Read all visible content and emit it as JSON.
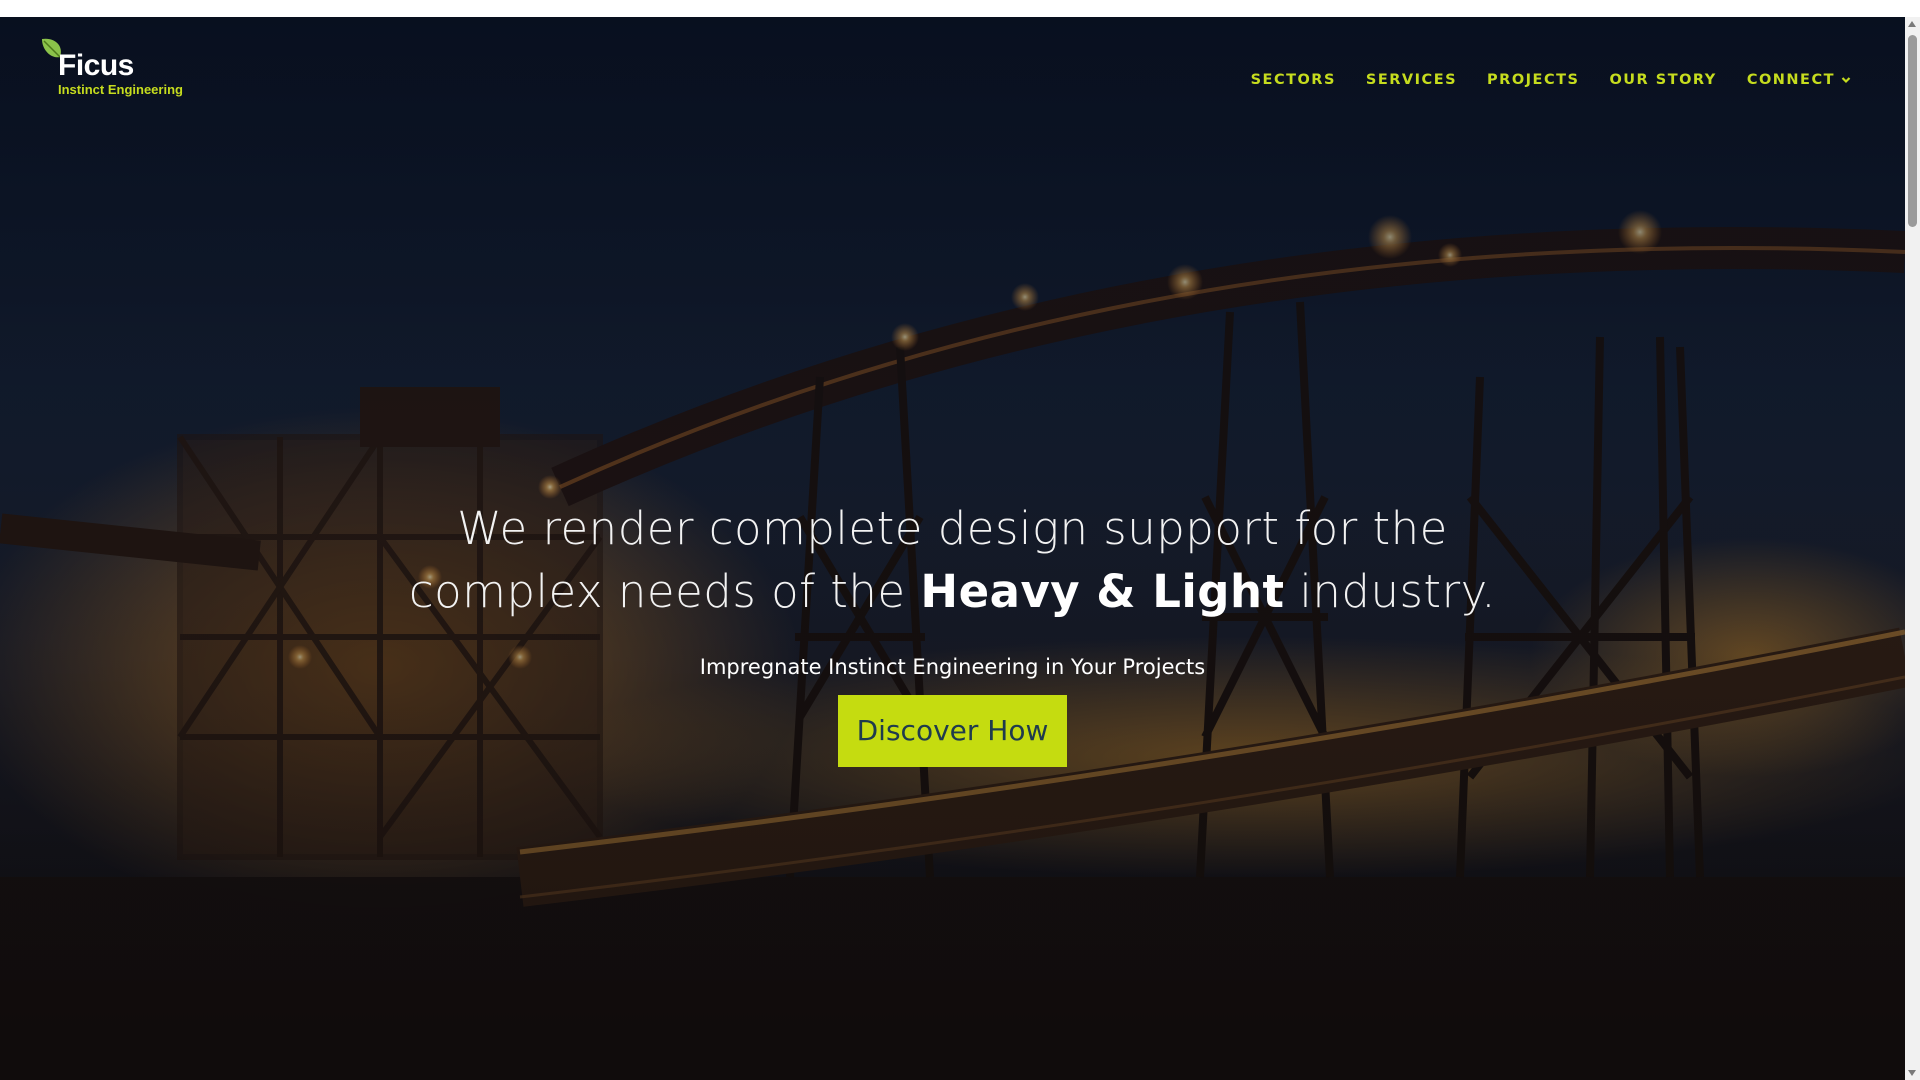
{
  "header": {
    "logo": {
      "name": "Ficus",
      "tagline": "Instinct Engineering",
      "icon": "leaf-icon"
    },
    "nav": [
      {
        "label": "SECTORS"
      },
      {
        "label": "SERVICES"
      },
      {
        "label": "PROJECTS"
      },
      {
        "label": "OUR STORY"
      },
      {
        "label": "CONNECT",
        "icon": "chevron-down-icon"
      }
    ]
  },
  "hero": {
    "headline_part1": "We render complete design support for the complex needs of the ",
    "headline_strong": "Heavy & Light",
    "headline_part2": " industry.",
    "subtitle": "Impregnate Instinct Engineering in Your Projects",
    "cta_label": "Discover How",
    "background": "industrial-conveyor-night-photo"
  },
  "colors": {
    "accent": "#c5dc10",
    "cta_text": "#1f3b4d",
    "nav_text": "#c6dc1e"
  }
}
